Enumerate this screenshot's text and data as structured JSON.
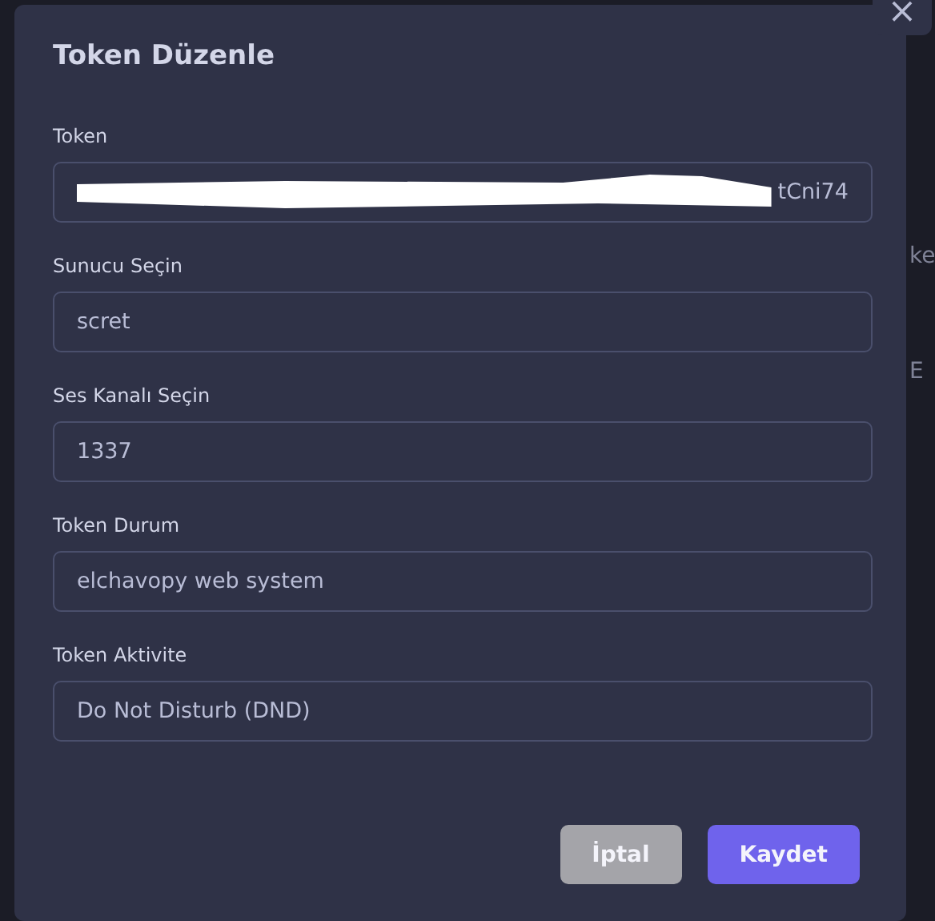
{
  "dialog": {
    "title": "Token Düzenle",
    "close": "×",
    "fields": [
      {
        "label": "Token",
        "value": "tCni74",
        "redacted": true
      },
      {
        "label": "Sunucu Seçin",
        "value": "scret",
        "redacted": false
      },
      {
        "label": "Ses Kanalı Seçin",
        "value": "1337",
        "redacted": false
      },
      {
        "label": "Token Durum",
        "value": "elchavopy web system",
        "redacted": false
      },
      {
        "label": "Token Aktivite",
        "value": "Do Not Disturb (DND)",
        "redacted": false
      }
    ],
    "buttons": [
      {
        "label": "İptal",
        "kind": "cancel"
      },
      {
        "label": "Kaydet",
        "kind": "primary"
      }
    ]
  },
  "backdrop": {
    "texts": [
      "ke",
      "E"
    ]
  }
}
